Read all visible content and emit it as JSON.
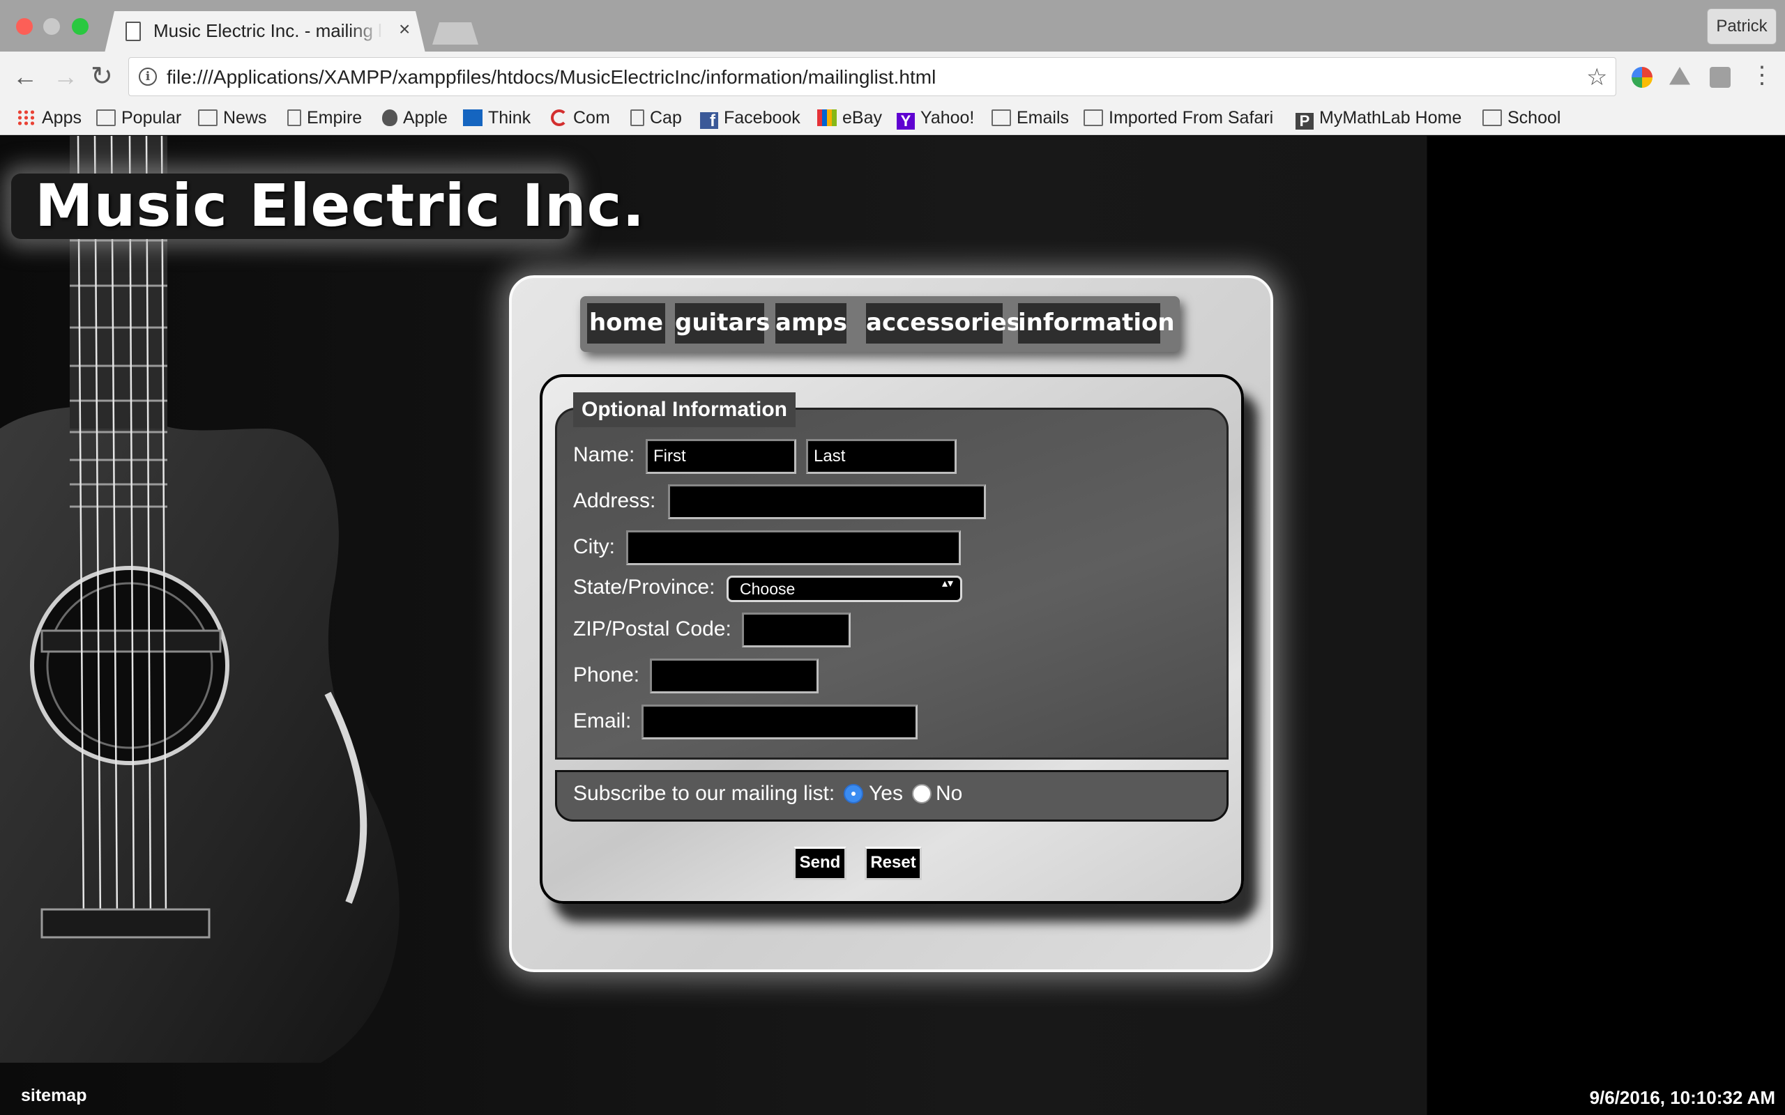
{
  "browser": {
    "tab_title": "Music Electric Inc. - mailing list",
    "tab_close": "×",
    "profile_name": "Patrick",
    "url": "file:///Applications/XAMPP/xamppfiles/htdocs/MusicElectricInc/information/mailinglist.html",
    "nav": {
      "back": "←",
      "forward": "→",
      "reload": "↻",
      "star": "☆",
      "menu": "⋮",
      "info": "i"
    },
    "bookmarks": [
      {
        "label": "Apps",
        "icon": "apps-grid-icon"
      },
      {
        "label": "Popular",
        "icon": "folder-icon"
      },
      {
        "label": "News",
        "icon": "folder-icon"
      },
      {
        "label": "Empire",
        "icon": "page-icon"
      },
      {
        "label": "Apple",
        "icon": "apple-icon"
      },
      {
        "label": "Think",
        "icon": "think-icon"
      },
      {
        "label": "Com",
        "icon": "com-icon"
      },
      {
        "label": "Cap",
        "icon": "page-icon"
      },
      {
        "label": "Facebook",
        "icon": "facebook-icon"
      },
      {
        "label": "eBay",
        "icon": "ebay-icon"
      },
      {
        "label": "Yahoo!",
        "icon": "yahoo-icon"
      },
      {
        "label": "Emails",
        "icon": "folder-icon"
      },
      {
        "label": "Imported From Safari",
        "icon": "folder-icon"
      },
      {
        "label": "MyMathLab Home",
        "icon": "mymathlab-icon"
      },
      {
        "label": "School",
        "icon": "folder-icon"
      }
    ],
    "fb_glyph": "f",
    "yahoo_glyph": "Y",
    "mml_glyph": "P"
  },
  "site": {
    "title": "Music Electric Inc.",
    "nav": [
      "home",
      "guitars",
      "amps",
      "accessories",
      "information"
    ]
  },
  "form": {
    "legend": "Optional Information",
    "labels": {
      "name": "Name:",
      "address": "Address:",
      "city": "City:",
      "state": "State/Province:",
      "zip": "ZIP/Postal Code:",
      "phone": "Phone:",
      "email": "Email:"
    },
    "placeholders": {
      "first": "First",
      "last": "Last"
    },
    "state_selected": "Choose",
    "select_arrows": "▴▾",
    "subscribe_label": "Subscribe to our mailing list:",
    "subscribe_options": [
      "Yes",
      "No"
    ],
    "subscribe_selected": "Yes",
    "buttons": {
      "send": "Send",
      "reset": "Reset"
    }
  },
  "footer": {
    "sitemap": "sitemap",
    "datetime": "9/6/2016, 10:10:32 AM"
  },
  "colors": {
    "page_bg": "#000000",
    "form_field_bg": "#000000",
    "fieldset_bg": "#555555",
    "radio_selected": "#3b8cf1"
  }
}
